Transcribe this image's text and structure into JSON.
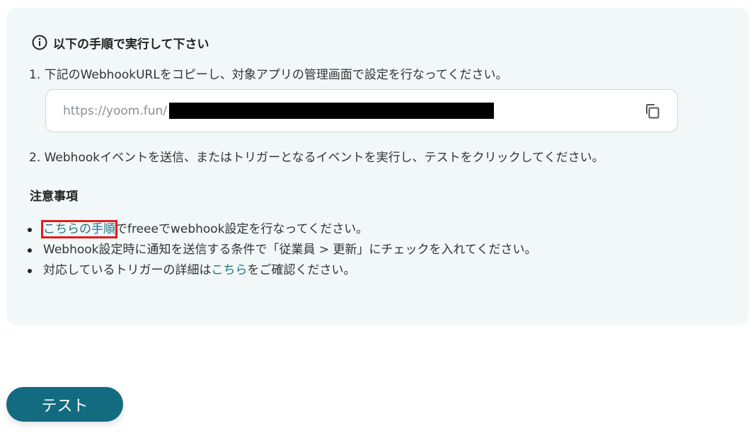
{
  "heading": "以下の手順で実行して下さい",
  "step1": "1. 下記のWebhookURLをコピーし、対象アプリの管理画面で設定を行なってください。",
  "url_box": {
    "value": "https://yoom.fun/"
  },
  "step2": "2. Webhookイベントを送信、またはトリガーとなるイベントを実行し、テストをクリックしてください。",
  "notes": {
    "title": "注意事項",
    "item1": {
      "link": "こちらの手順",
      "rest": "でfreeeでwebhook設定を行なってください。"
    },
    "item2": "Webhook設定時に通知を送信する条件で「従業員 > 更新」にチェックを入れてください。",
    "item3": {
      "before": "対応しているトリガーの詳細は",
      "link": "こちら",
      "after": "をご確認ください。"
    }
  },
  "test_button": "テスト",
  "colors": {
    "panel_bg": "#f1f8f7",
    "link": "#1f7089",
    "button": "#136b80",
    "highlight": "#e21b1b"
  },
  "icons": {
    "info": "info-circle-icon",
    "copy": "copy-icon"
  }
}
